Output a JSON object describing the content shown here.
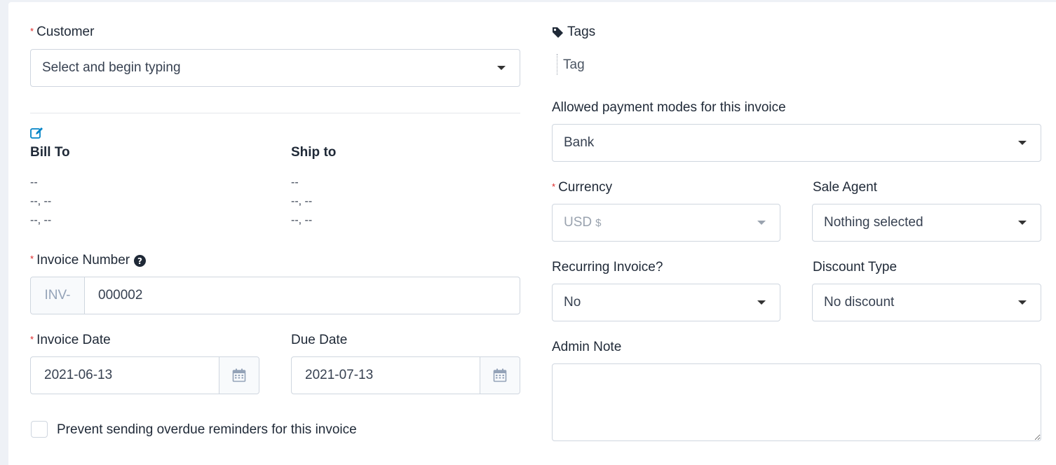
{
  "left": {
    "customer": {
      "label": "Customer",
      "placeholder": "Select and begin typing"
    },
    "bill_to": {
      "title": "Bill To",
      "lines": [
        "--",
        "--, --",
        "--, --"
      ]
    },
    "ship_to": {
      "title": "Ship to",
      "lines": [
        "--",
        "--, --",
        "--, --"
      ]
    },
    "invoice_number": {
      "label": "Invoice Number",
      "prefix": "INV-",
      "value": "000002"
    },
    "invoice_date": {
      "label": "Invoice Date",
      "value": "2021-06-13"
    },
    "due_date": {
      "label": "Due Date",
      "value": "2021-07-13"
    },
    "prevent_reminders": {
      "label": "Prevent sending overdue reminders for this invoice",
      "checked": false
    }
  },
  "right": {
    "tags": {
      "label": "Tags",
      "placeholder": "Tag"
    },
    "payment_modes": {
      "label": "Allowed payment modes for this invoice",
      "value": "Bank"
    },
    "currency": {
      "label": "Currency",
      "value": "USD",
      "symbol": "$"
    },
    "sale_agent": {
      "label": "Sale Agent",
      "value": "Nothing selected"
    },
    "recurring": {
      "label": "Recurring Invoice?",
      "value": "No"
    },
    "discount_type": {
      "label": "Discount Type",
      "value": "No discount"
    },
    "admin_note": {
      "label": "Admin Note",
      "value": ""
    }
  },
  "icons": {
    "edit": "edit-icon",
    "tag": "tag-icon",
    "help": "question-circle-icon",
    "calendar": "calendar-icon",
    "caret": "chevron-down-icon"
  },
  "colors": {
    "required": "#dc2626",
    "accent": "#0284c7",
    "border": "#cfd6df"
  }
}
